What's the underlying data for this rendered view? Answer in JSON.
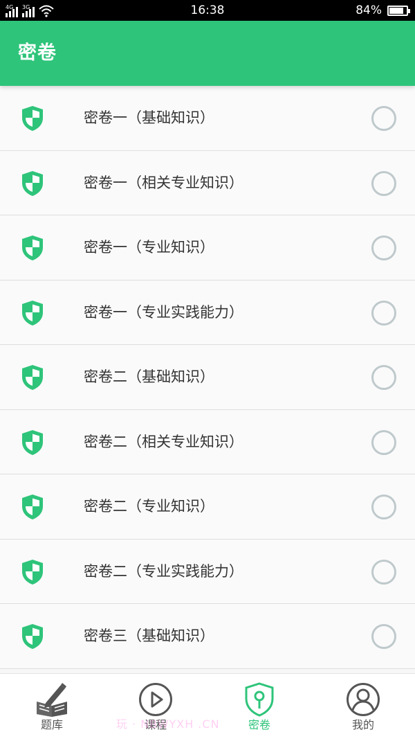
{
  "status_bar": {
    "network_1": "4G",
    "network_2": "3G",
    "time": "16:38",
    "battery_text": "84%",
    "battery_level": 0.84
  },
  "header": {
    "title": "密卷"
  },
  "paper_list": [
    {
      "label": "密卷一（基础知识）",
      "selected": false
    },
    {
      "label": "密卷一（相关专业知识）",
      "selected": false
    },
    {
      "label": "密卷一（专业知识）",
      "selected": false
    },
    {
      "label": "密卷一（专业实践能力）",
      "selected": false
    },
    {
      "label": "密卷二（基础知识）",
      "selected": false
    },
    {
      "label": "密卷二（相关专业知识）",
      "selected": false
    },
    {
      "label": "密卷二（专业知识）",
      "selected": false
    },
    {
      "label": "密卷二（专业实践能力）",
      "selected": false
    },
    {
      "label": "密卷三（基础知识）",
      "selected": false
    }
  ],
  "bottom_nav": [
    {
      "label": "题库",
      "icon": "book-pen-icon",
      "active": false
    },
    {
      "label": "课程",
      "icon": "play-circle-icon",
      "active": false
    },
    {
      "label": "密卷",
      "icon": "shield-key-icon",
      "active": true
    },
    {
      "label": "我的",
      "icon": "user-circle-icon",
      "active": false
    }
  ],
  "watermark": "玩 · NBWYXH .CN",
  "colors": {
    "accent": "#2ec47a",
    "radio_border": "#bfc9cc",
    "text": "#333333"
  }
}
